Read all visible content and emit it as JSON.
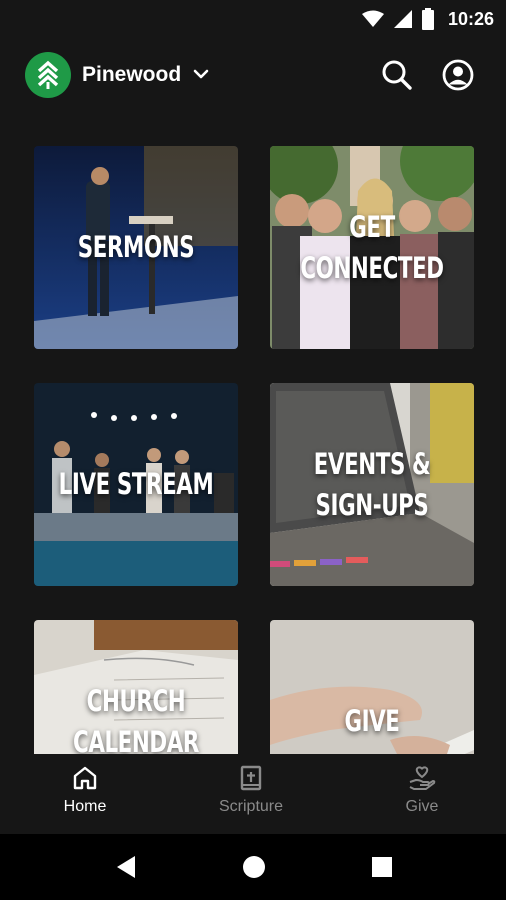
{
  "status_bar": {
    "time": "10:26",
    "icons": [
      "wifi-icon",
      "signal-icon",
      "battery-icon"
    ]
  },
  "header": {
    "org_name": "Pinewood",
    "logo_color": "#1f9a47",
    "icons": [
      "chevron-down-icon",
      "search-icon",
      "account-icon"
    ]
  },
  "tiles": [
    {
      "label": "SERMONS"
    },
    {
      "label": "GET CONNECTED"
    },
    {
      "label": "LIVE STREAM"
    },
    {
      "label": "EVENTS &\nSIGN-UPS"
    },
    {
      "label": "CHURCH\nCALENDAR"
    },
    {
      "label": "GIVE"
    }
  ],
  "bottom_nav": {
    "items": [
      {
        "label": "Home",
        "icon": "home-icon",
        "active": true
      },
      {
        "label": "Scripture",
        "icon": "bible-icon",
        "active": false
      },
      {
        "label": "Give",
        "icon": "give-hand-heart-icon",
        "active": false
      }
    ],
    "active_color": "#ffffff",
    "inactive_color": "#8a8a8a"
  },
  "system_nav": {
    "buttons": [
      "back-icon",
      "home-circle-icon",
      "recents-icon"
    ]
  }
}
